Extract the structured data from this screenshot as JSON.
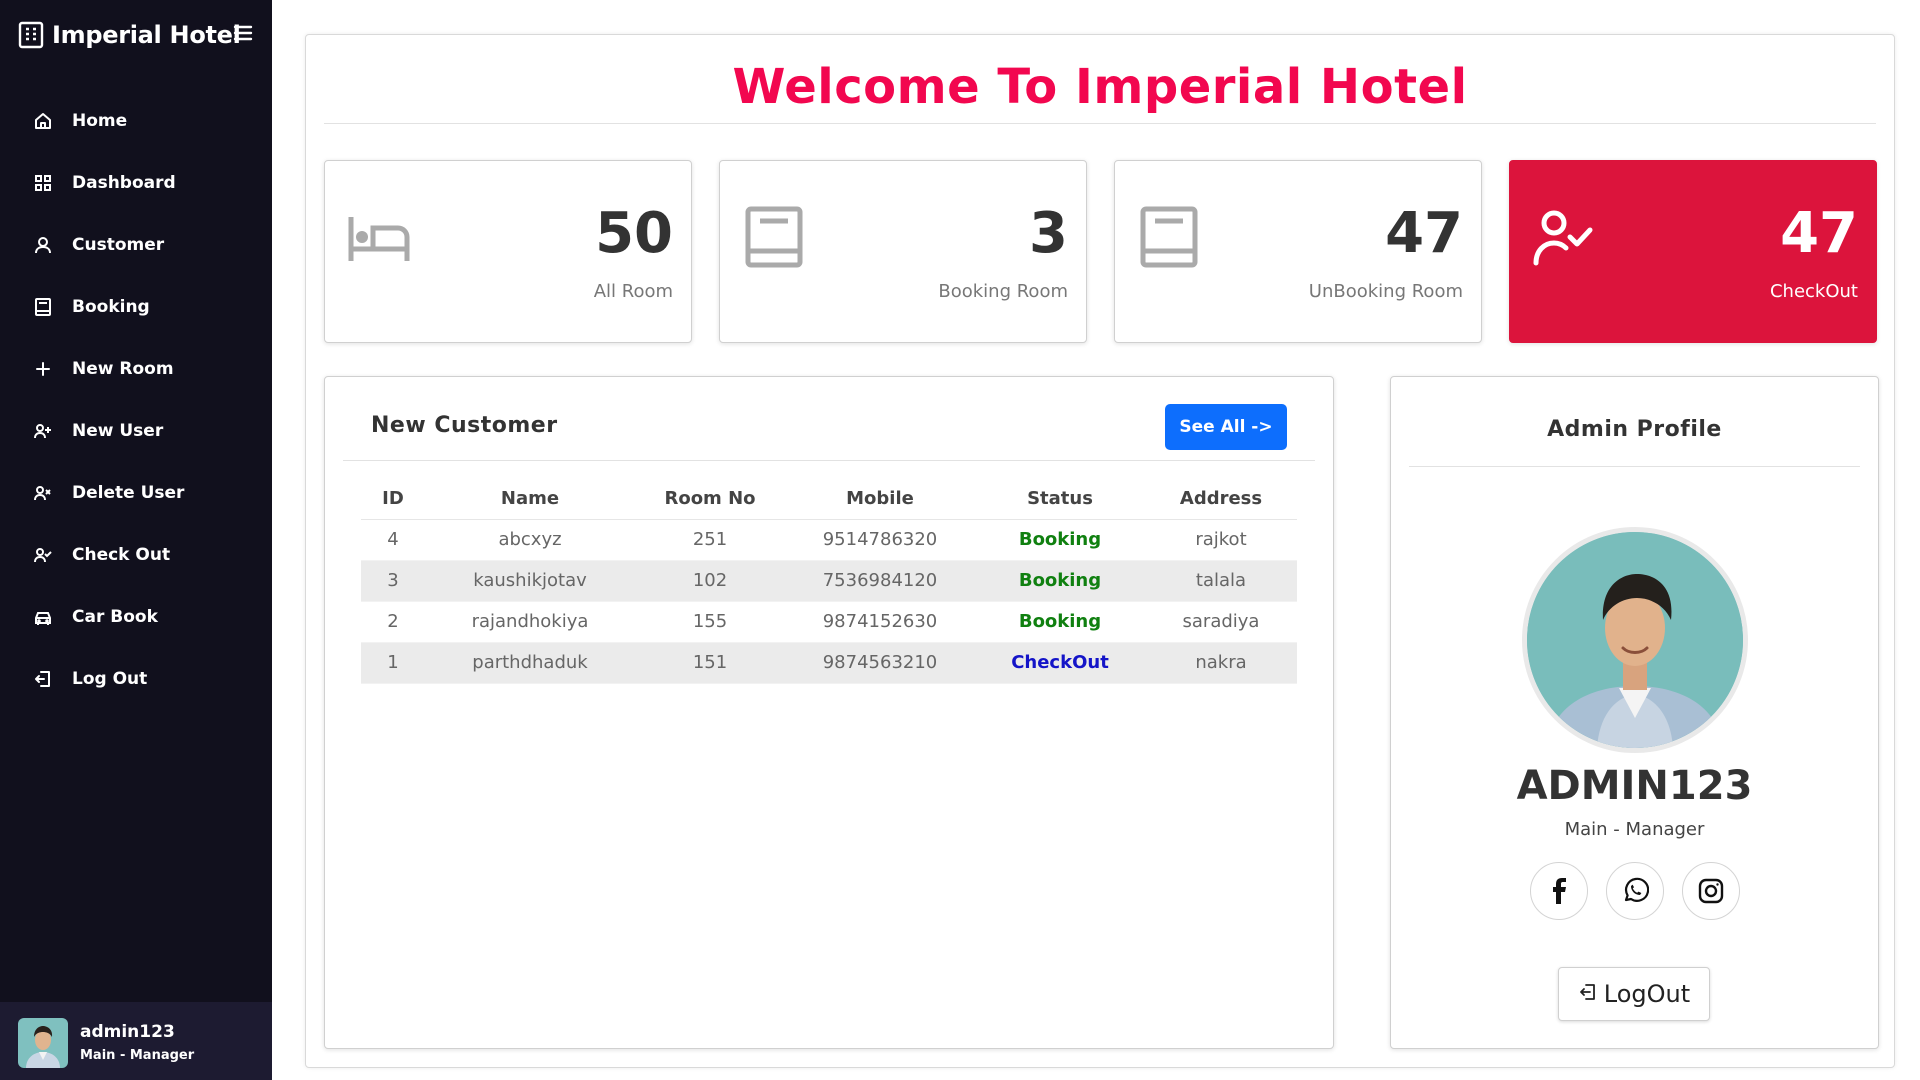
{
  "app": {
    "title": "Imperial Hotel"
  },
  "sidebar": {
    "items": [
      {
        "label": "Home",
        "icon": "home-icon"
      },
      {
        "label": "Dashboard",
        "icon": "grid-icon"
      },
      {
        "label": "Customer",
        "icon": "user-icon"
      },
      {
        "label": "Booking",
        "icon": "book-icon"
      },
      {
        "label": "New Room",
        "icon": "plus-icon"
      },
      {
        "label": "New User",
        "icon": "user-plus-icon"
      },
      {
        "label": "Delete User",
        "icon": "user-x-icon"
      },
      {
        "label": "Check Out",
        "icon": "user-check-icon"
      },
      {
        "label": "Car Book",
        "icon": "car-icon"
      },
      {
        "label": "Log Out",
        "icon": "logout-icon"
      }
    ],
    "profile": {
      "name": "admin123",
      "role": "Main - Manager"
    }
  },
  "main": {
    "welcome": "Welcome To Imperial Hotel",
    "cards": [
      {
        "value": "50",
        "label": "All Room",
        "icon": "bed-icon"
      },
      {
        "value": "3",
        "label": "Booking Room",
        "icon": "book-icon"
      },
      {
        "value": "47",
        "label": "UnBooking Room",
        "icon": "book-icon"
      },
      {
        "value": "47",
        "label": "CheckOut",
        "icon": "user-check-icon"
      }
    ],
    "customers": {
      "title": "New Customer",
      "see_all": "See All ->",
      "columns": [
        "ID",
        "Name",
        "Room No",
        "Mobile",
        "Status",
        "Address"
      ],
      "rows": [
        [
          "4",
          "abcxyz",
          "251",
          "9514786320",
          "Booking",
          "rajkot"
        ],
        [
          "3",
          "kaushikjotav",
          "102",
          "7536984120",
          "Booking",
          "talala"
        ],
        [
          "2",
          "rajandhokiya",
          "155",
          "9874152630",
          "Booking",
          "saradiya"
        ],
        [
          "1",
          "parthdhaduk",
          "151",
          "9874563210",
          "CheckOut",
          "nakra"
        ]
      ]
    },
    "admin": {
      "title": "Admin Profile",
      "name": "ADMIN123",
      "role": "Main - Manager",
      "logout": "LogOut"
    }
  },
  "colors": {
    "sidebar_bg": "#11101d",
    "sidebar_profile_bg": "#1d1b31",
    "accent_pink": "#f2074f",
    "checkout_card": "#dc143c",
    "primary_button": "#0d6efd",
    "status_booking": "#108010",
    "status_checkout": "#1414c8"
  }
}
